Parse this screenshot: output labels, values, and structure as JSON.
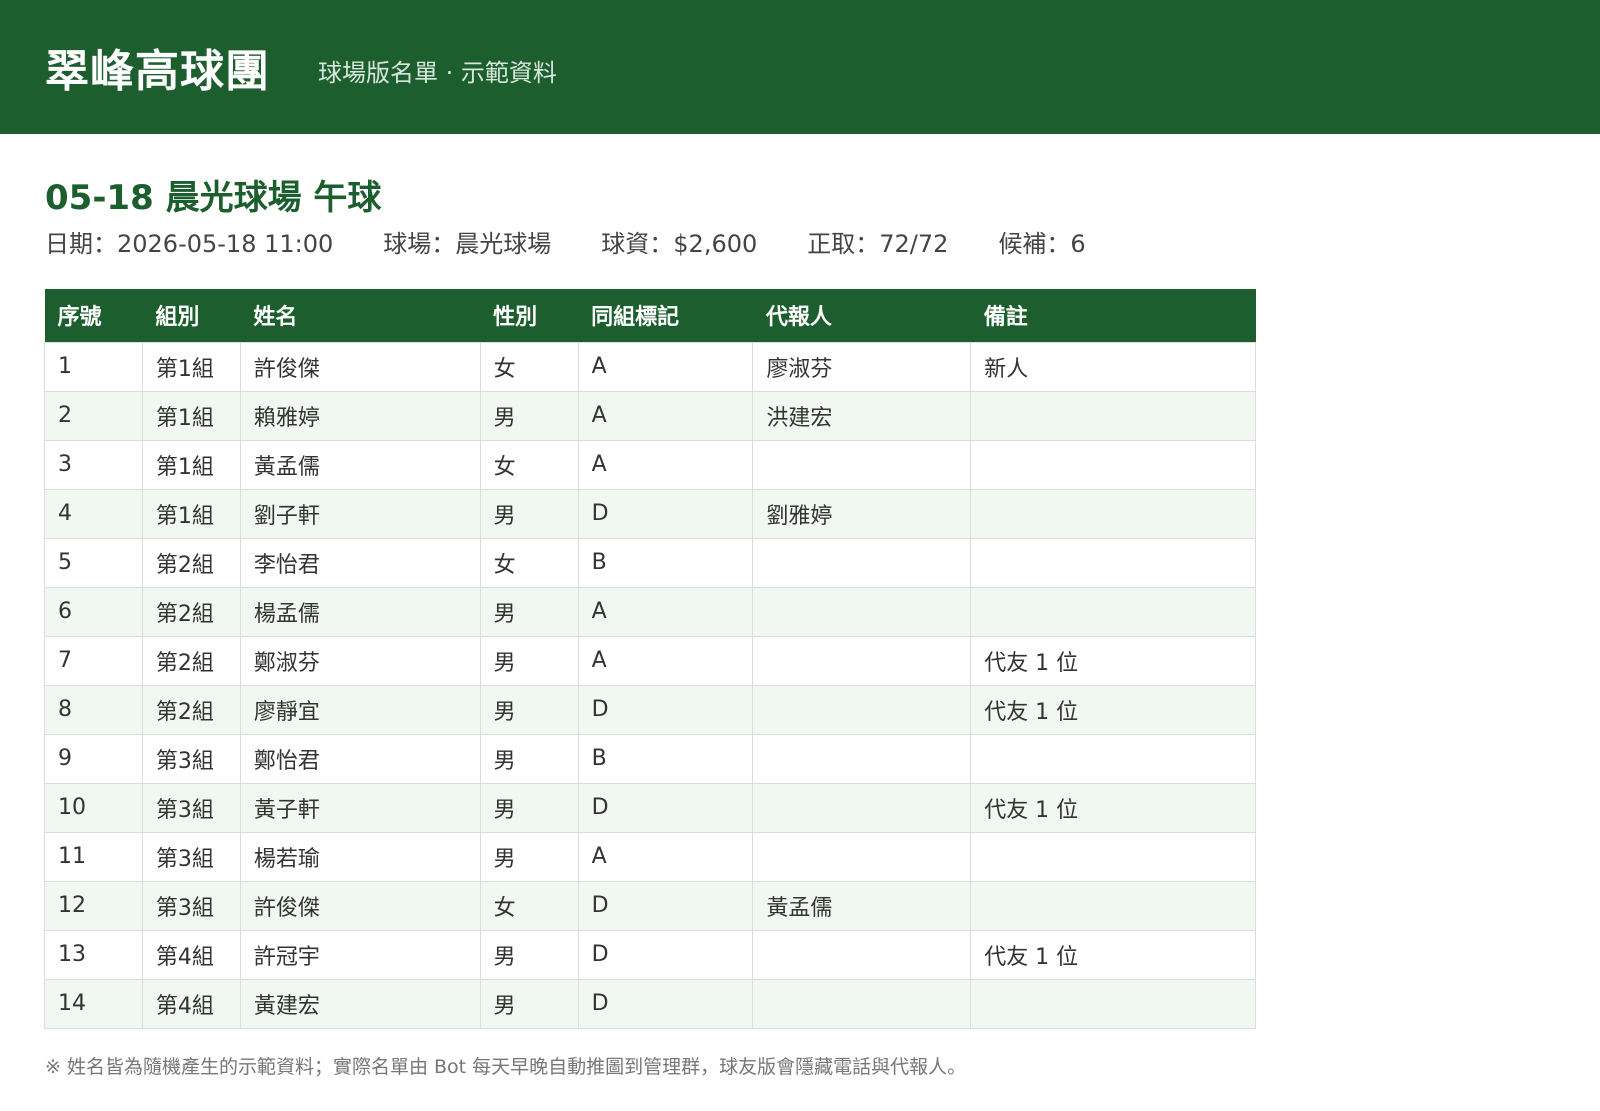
{
  "header": {
    "brand": "翠峰高球團",
    "subtitle": "球場版名單 · 示範資料"
  },
  "event": {
    "title": "05-18 晨光球場 午球",
    "date": "日期：2026-05-18 11:00",
    "course": "球場：晨光球場",
    "fee": "球資：$2,600",
    "confirmed": "正取：72/72",
    "waitlist": "候補：6"
  },
  "table": {
    "columns": [
      "序號",
      "組別",
      "姓名",
      "性別",
      "同組標記",
      "代報人",
      "備註"
    ],
    "rows": [
      [
        "1",
        "第1組",
        "許俊傑",
        "女",
        "A",
        "廖淑芬",
        "新人"
      ],
      [
        "2",
        "第1組",
        "賴雅婷",
        "男",
        "A",
        "洪建宏",
        ""
      ],
      [
        "3",
        "第1組",
        "黃孟儒",
        "女",
        "A",
        "",
        ""
      ],
      [
        "4",
        "第1組",
        "劉子軒",
        "男",
        "D",
        "劉雅婷",
        ""
      ],
      [
        "5",
        "第2組",
        "李怡君",
        "女",
        "B",
        "",
        ""
      ],
      [
        "6",
        "第2組",
        "楊孟儒",
        "男",
        "A",
        "",
        ""
      ],
      [
        "7",
        "第2組",
        "鄭淑芬",
        "男",
        "A",
        "",
        "代友 1 位"
      ],
      [
        "8",
        "第2組",
        "廖靜宜",
        "男",
        "D",
        "",
        "代友 1 位"
      ],
      [
        "9",
        "第3組",
        "鄭怡君",
        "男",
        "B",
        "",
        ""
      ],
      [
        "10",
        "第3組",
        "黃子軒",
        "男",
        "D",
        "",
        "代友 1 位"
      ],
      [
        "11",
        "第3組",
        "楊若瑜",
        "男",
        "A",
        "",
        ""
      ],
      [
        "12",
        "第3組",
        "許俊傑",
        "女",
        "D",
        "黃孟儒",
        ""
      ],
      [
        "13",
        "第4組",
        "許冠宇",
        "男",
        "D",
        "",
        "代友 1 位"
      ],
      [
        "14",
        "第4組",
        "黃建宏",
        "男",
        "D",
        "",
        ""
      ]
    ]
  },
  "footnote": "※ 姓名皆為隨機產生的示範資料；實際名單由 Bot 每天早晚自動推圖到管理群，球友版會隱藏電話與代報人。",
  "colors": {
    "brand_green": "#1c5e2e",
    "row_alt": "#f1f8f2"
  }
}
